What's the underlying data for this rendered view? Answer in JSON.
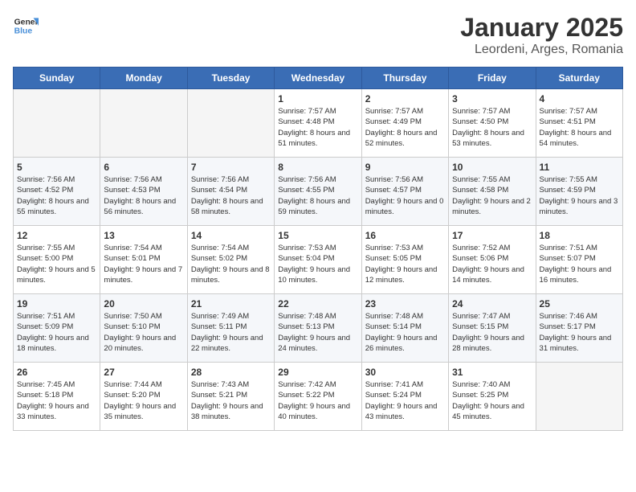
{
  "header": {
    "logo_line1": "General",
    "logo_line2": "Blue",
    "title": "January 2025",
    "subtitle": "Leordeni, Arges, Romania"
  },
  "days_of_week": [
    "Sunday",
    "Monday",
    "Tuesday",
    "Wednesday",
    "Thursday",
    "Friday",
    "Saturday"
  ],
  "weeks": [
    [
      {
        "day": "",
        "info": ""
      },
      {
        "day": "",
        "info": ""
      },
      {
        "day": "",
        "info": ""
      },
      {
        "day": "1",
        "info": "Sunrise: 7:57 AM\nSunset: 4:48 PM\nDaylight: 8 hours and 51 minutes."
      },
      {
        "day": "2",
        "info": "Sunrise: 7:57 AM\nSunset: 4:49 PM\nDaylight: 8 hours and 52 minutes."
      },
      {
        "day": "3",
        "info": "Sunrise: 7:57 AM\nSunset: 4:50 PM\nDaylight: 8 hours and 53 minutes."
      },
      {
        "day": "4",
        "info": "Sunrise: 7:57 AM\nSunset: 4:51 PM\nDaylight: 8 hours and 54 minutes."
      }
    ],
    [
      {
        "day": "5",
        "info": "Sunrise: 7:56 AM\nSunset: 4:52 PM\nDaylight: 8 hours and 55 minutes."
      },
      {
        "day": "6",
        "info": "Sunrise: 7:56 AM\nSunset: 4:53 PM\nDaylight: 8 hours and 56 minutes."
      },
      {
        "day": "7",
        "info": "Sunrise: 7:56 AM\nSunset: 4:54 PM\nDaylight: 8 hours and 58 minutes."
      },
      {
        "day": "8",
        "info": "Sunrise: 7:56 AM\nSunset: 4:55 PM\nDaylight: 8 hours and 59 minutes."
      },
      {
        "day": "9",
        "info": "Sunrise: 7:56 AM\nSunset: 4:57 PM\nDaylight: 9 hours and 0 minutes."
      },
      {
        "day": "10",
        "info": "Sunrise: 7:55 AM\nSunset: 4:58 PM\nDaylight: 9 hours and 2 minutes."
      },
      {
        "day": "11",
        "info": "Sunrise: 7:55 AM\nSunset: 4:59 PM\nDaylight: 9 hours and 3 minutes."
      }
    ],
    [
      {
        "day": "12",
        "info": "Sunrise: 7:55 AM\nSunset: 5:00 PM\nDaylight: 9 hours and 5 minutes."
      },
      {
        "day": "13",
        "info": "Sunrise: 7:54 AM\nSunset: 5:01 PM\nDaylight: 9 hours and 7 minutes."
      },
      {
        "day": "14",
        "info": "Sunrise: 7:54 AM\nSunset: 5:02 PM\nDaylight: 9 hours and 8 minutes."
      },
      {
        "day": "15",
        "info": "Sunrise: 7:53 AM\nSunset: 5:04 PM\nDaylight: 9 hours and 10 minutes."
      },
      {
        "day": "16",
        "info": "Sunrise: 7:53 AM\nSunset: 5:05 PM\nDaylight: 9 hours and 12 minutes."
      },
      {
        "day": "17",
        "info": "Sunrise: 7:52 AM\nSunset: 5:06 PM\nDaylight: 9 hours and 14 minutes."
      },
      {
        "day": "18",
        "info": "Sunrise: 7:51 AM\nSunset: 5:07 PM\nDaylight: 9 hours and 16 minutes."
      }
    ],
    [
      {
        "day": "19",
        "info": "Sunrise: 7:51 AM\nSunset: 5:09 PM\nDaylight: 9 hours and 18 minutes."
      },
      {
        "day": "20",
        "info": "Sunrise: 7:50 AM\nSunset: 5:10 PM\nDaylight: 9 hours and 20 minutes."
      },
      {
        "day": "21",
        "info": "Sunrise: 7:49 AM\nSunset: 5:11 PM\nDaylight: 9 hours and 22 minutes."
      },
      {
        "day": "22",
        "info": "Sunrise: 7:48 AM\nSunset: 5:13 PM\nDaylight: 9 hours and 24 minutes."
      },
      {
        "day": "23",
        "info": "Sunrise: 7:48 AM\nSunset: 5:14 PM\nDaylight: 9 hours and 26 minutes."
      },
      {
        "day": "24",
        "info": "Sunrise: 7:47 AM\nSunset: 5:15 PM\nDaylight: 9 hours and 28 minutes."
      },
      {
        "day": "25",
        "info": "Sunrise: 7:46 AM\nSunset: 5:17 PM\nDaylight: 9 hours and 31 minutes."
      }
    ],
    [
      {
        "day": "26",
        "info": "Sunrise: 7:45 AM\nSunset: 5:18 PM\nDaylight: 9 hours and 33 minutes."
      },
      {
        "day": "27",
        "info": "Sunrise: 7:44 AM\nSunset: 5:20 PM\nDaylight: 9 hours and 35 minutes."
      },
      {
        "day": "28",
        "info": "Sunrise: 7:43 AM\nSunset: 5:21 PM\nDaylight: 9 hours and 38 minutes."
      },
      {
        "day": "29",
        "info": "Sunrise: 7:42 AM\nSunset: 5:22 PM\nDaylight: 9 hours and 40 minutes."
      },
      {
        "day": "30",
        "info": "Sunrise: 7:41 AM\nSunset: 5:24 PM\nDaylight: 9 hours and 43 minutes."
      },
      {
        "day": "31",
        "info": "Sunrise: 7:40 AM\nSunset: 5:25 PM\nDaylight: 9 hours and 45 minutes."
      },
      {
        "day": "",
        "info": ""
      }
    ]
  ]
}
